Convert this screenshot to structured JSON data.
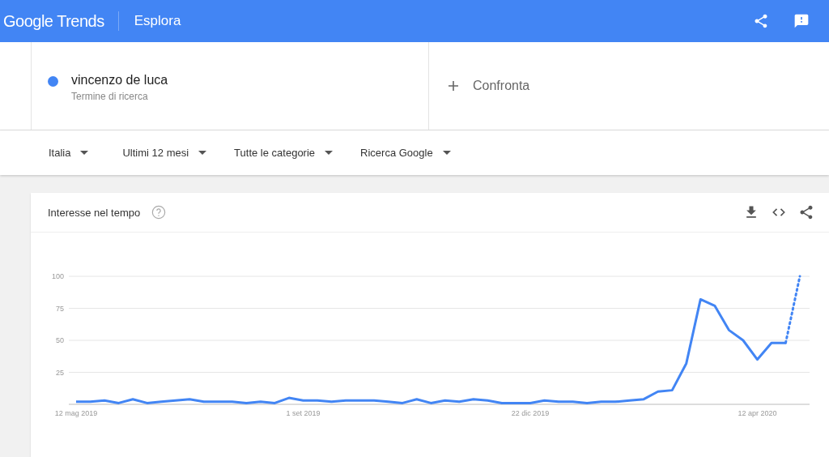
{
  "header": {
    "logo": "Google Trends",
    "section": "Esplora"
  },
  "search_term": {
    "name": "vincenzo de luca",
    "subtitle": "Termine di ricerca",
    "color": "#4285f4"
  },
  "compare": {
    "label": "Confronta"
  },
  "filters": [
    "Italia",
    "Ultimi 12 mesi",
    "Tutte le categorie",
    "Ricerca Google"
  ],
  "chart_card": {
    "title": "Interesse nel tempo",
    "last_point_partial": true,
    "chart_data": {
      "type": "line",
      "categories": [
        "12 mag 2019",
        null,
        null,
        null,
        null,
        null,
        null,
        null,
        null,
        null,
        null,
        null,
        null,
        null,
        null,
        null,
        "1 set 2019",
        null,
        null,
        null,
        null,
        null,
        null,
        null,
        null,
        null,
        null,
        null,
        null,
        null,
        null,
        null,
        "22 dic 2019",
        null,
        null,
        null,
        null,
        null,
        null,
        null,
        null,
        null,
        null,
        null,
        null,
        null,
        null,
        null,
        "12 apr 2020",
        null,
        null,
        null
      ],
      "series": [
        {
          "color": "#4285f4",
          "values": [
            2,
            2,
            3,
            1,
            4,
            1,
            2,
            3,
            4,
            2,
            2,
            2,
            1,
            2,
            1,
            5,
            3,
            3,
            2,
            3,
            3,
            3,
            2,
            1,
            4,
            1,
            3,
            2,
            4,
            3,
            1,
            1,
            1,
            3,
            2,
            2,
            1,
            2,
            2,
            3,
            4,
            10,
            11,
            32,
            82,
            77,
            58,
            50,
            35,
            48,
            48,
            100
          ]
        }
      ],
      "ylim": [
        0,
        100
      ],
      "yticks": [
        25,
        50,
        75,
        100
      ],
      "grid": true
    }
  }
}
